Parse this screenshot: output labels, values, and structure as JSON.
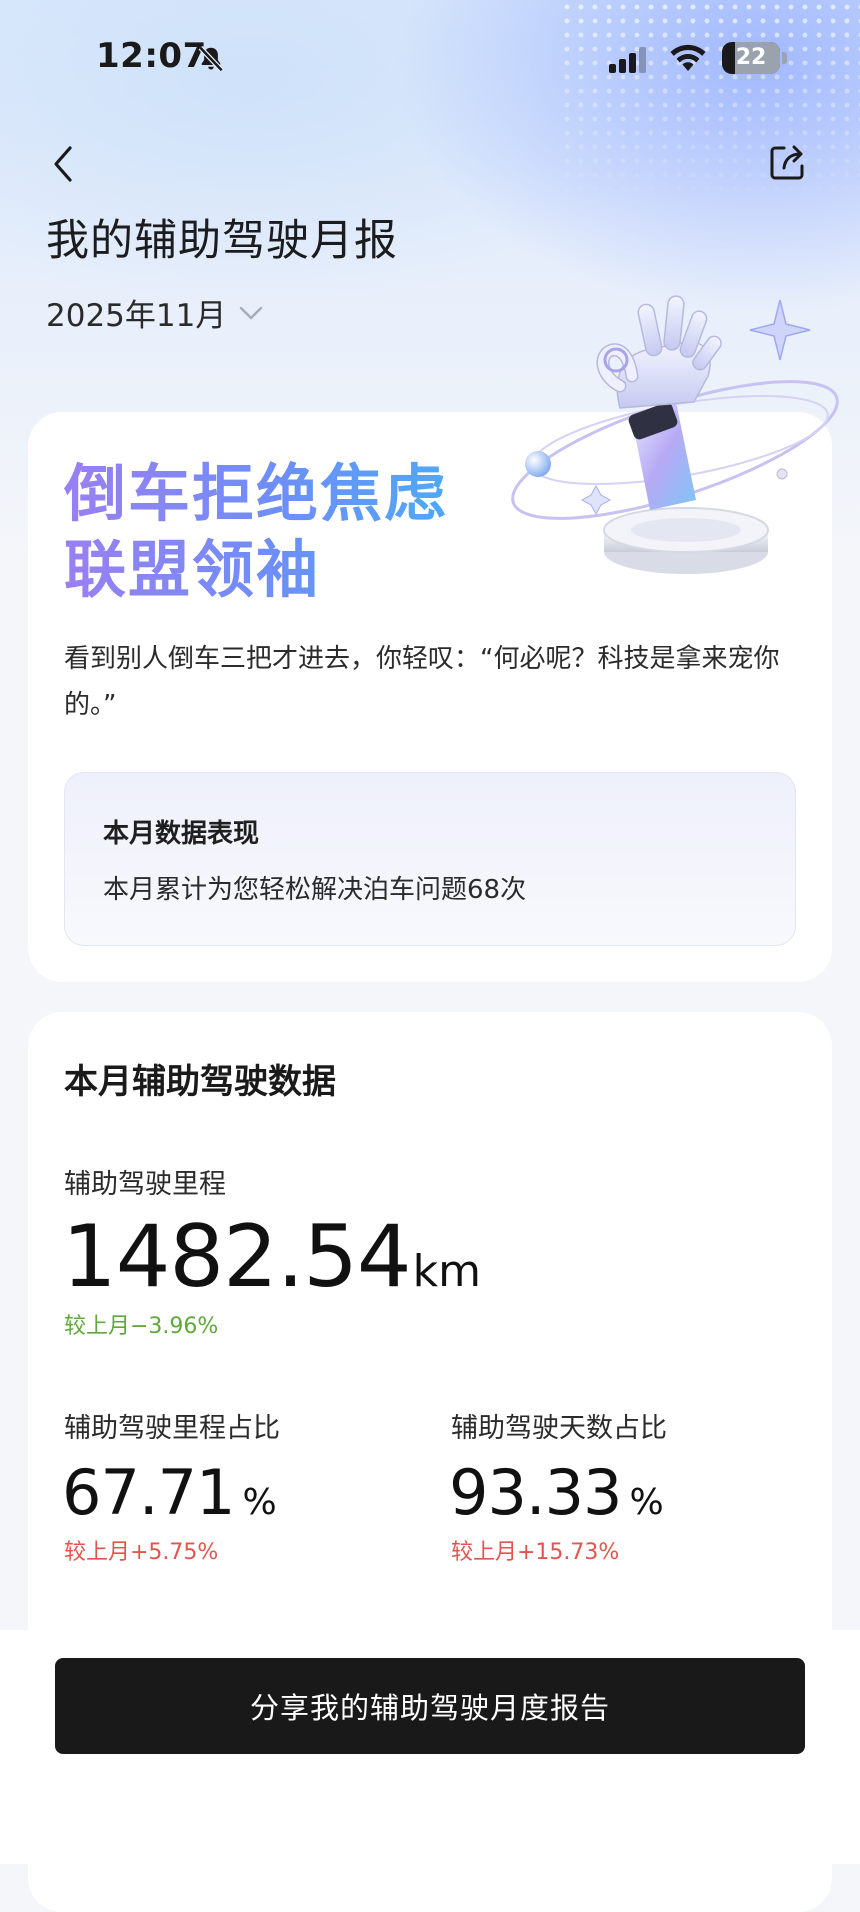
{
  "status_bar": {
    "time": "12:07",
    "battery": "22",
    "battery_level": 0.22
  },
  "header": {
    "title": "我的辅助驾驶月报",
    "month": "2025年11月"
  },
  "hero": {
    "title_line1": "倒车拒绝焦虑",
    "title_line2": "联盟领袖",
    "description": "看到别人倒车三把才进去，你轻叹：“何必呢？科技是拿来宠你的。”",
    "stats_title": "本月数据表现",
    "stats_text": "本月累计为您轻松解决泊车问题68次"
  },
  "data_card": {
    "title": "本月辅助驾驶数据",
    "mileage": {
      "label": "辅助驾驶里程",
      "value": "1482.54",
      "unit": "km",
      "change": "较上月−3.96%"
    },
    "mileage_ratio": {
      "label": "辅助驾驶里程占比",
      "value": "67.71",
      "unit": "%",
      "change": "较上月+5.75%"
    },
    "days_ratio": {
      "label": "辅助驾驶天数占比",
      "value": "93.33",
      "unit": "%",
      "change": "较上月+15.73%"
    }
  },
  "footer": {
    "share_button": "分享我的辅助驾驶月度报告"
  },
  "colors": {
    "accent_purple": "#9a7ff2",
    "accent_blue": "#4fa8f7",
    "decrease": "#5fa83a",
    "increase": "#e2554f",
    "button": "#191919"
  },
  "icons": [
    "bell-slash-icon",
    "signal-icon",
    "wifi-icon",
    "back-icon",
    "share-icon",
    "chevron-down-icon",
    "robot-hand-illustration"
  ]
}
